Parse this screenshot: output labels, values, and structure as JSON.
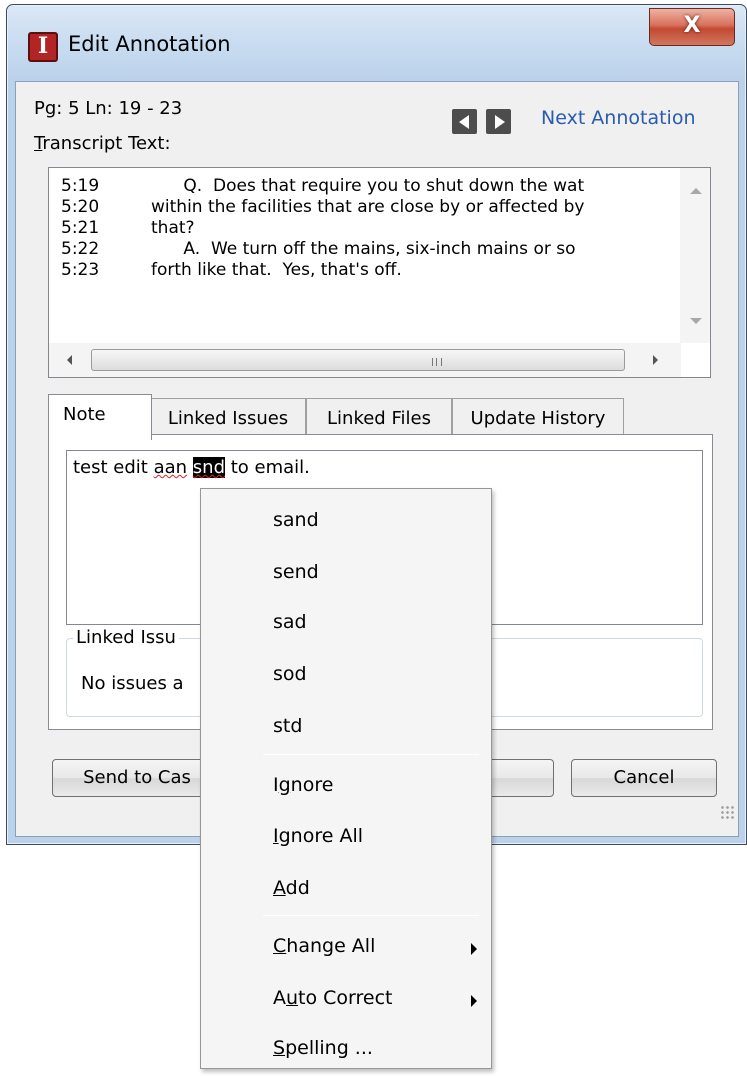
{
  "window": {
    "title": "Edit Annotation",
    "app_icon_letter": "I",
    "close_glyph": "X"
  },
  "header": {
    "page_line": "Pg: 5 Ln: 19 - 23",
    "transcript_label_pre": "",
    "transcript_label_underlined": "T",
    "transcript_label_post": "ranscript Text:",
    "next_annotation_label": "Next Annotation",
    "accent_color": "#2a5cae"
  },
  "transcript": {
    "lines": [
      {
        "num": "5:19",
        "text": "      Q.  Does that require you to shut down the wat"
      },
      {
        "num": "5:20",
        "text": "within the facilities that are close by or affected by"
      },
      {
        "num": "5:21",
        "text": "that?"
      },
      {
        "num": "5:22",
        "text": "      A.  We turn off the mains, six-inch mains or so"
      },
      {
        "num": "5:23",
        "text": "forth like that.  Yes, that's off."
      }
    ]
  },
  "tabs": [
    {
      "label": "Note",
      "active": true
    },
    {
      "label": "Linked Issues",
      "active": false
    },
    {
      "label": "Linked Files",
      "active": false
    },
    {
      "label": "Update History",
      "active": false
    }
  ],
  "note": {
    "text_before": "test edit ",
    "misspelled_1": "aan",
    "space": " ",
    "selected_word": "snd",
    "text_after": " to email."
  },
  "linked_issues": {
    "title": "Linked Issu",
    "empty_text": "No issues a"
  },
  "buttons": {
    "send_to_case": "Send to Cas",
    "ok_partial": "(",
    "cancel": "Cancel"
  },
  "context_menu": {
    "suggestions": [
      "sand",
      "send",
      "sad",
      "sod",
      "std"
    ],
    "ignore": {
      "pre": "I",
      "u": "g",
      "post": "nore"
    },
    "ignore_all": {
      "pre": "",
      "u": "I",
      "post": "gnore All"
    },
    "add": {
      "pre": "",
      "u": "A",
      "post": "dd"
    },
    "change_all": {
      "pre": "",
      "u": "C",
      "post": "hange All"
    },
    "auto_correct": {
      "pre": "A",
      "u": "u",
      "post": "to Correct"
    },
    "spelling": {
      "pre": "",
      "u": "S",
      "post": "pelling ..."
    }
  },
  "icons": {
    "prev": "triangle-left-icon",
    "next": "triangle-right-icon",
    "submenu": "chevron-right-icon"
  }
}
